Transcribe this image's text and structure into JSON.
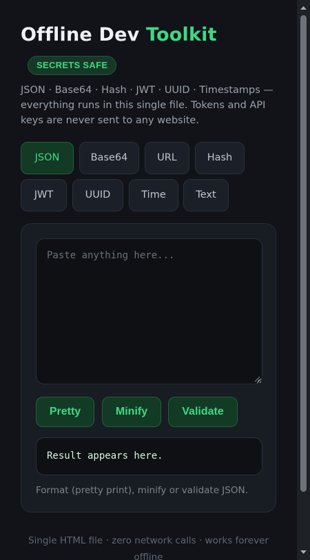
{
  "header": {
    "title_main": "Offline Dev ",
    "title_accent": "Toolkit",
    "badge": "SECRETS SAFE",
    "description": "JSON · Base64 · Hash · JWT · UUID · Timestamps — everything runs in this single file. Tokens and API keys are never sent to any website."
  },
  "tabs": [
    {
      "label": "JSON",
      "active": true
    },
    {
      "label": "Base64",
      "active": false
    },
    {
      "label": "URL",
      "active": false
    },
    {
      "label": "Hash",
      "active": false
    },
    {
      "label": "JWT",
      "active": false
    },
    {
      "label": "UUID",
      "active": false
    },
    {
      "label": "Time",
      "active": false
    },
    {
      "label": "Text",
      "active": false
    }
  ],
  "panel": {
    "input_placeholder": "Paste anything here...",
    "input_value": "",
    "buttons": {
      "pretty": "Pretty",
      "minify": "Minify",
      "validate": "Validate"
    },
    "result": "Result appears here.",
    "hint": "Format (pretty print), minify or validate JSON."
  },
  "footer": "Single HTML file · zero network calls · works forever offline",
  "colors": {
    "background": "#111318",
    "accent": "#3fd884",
    "panel": "#181c23",
    "button_bg": "#133a25"
  },
  "icons": {
    "resize": "resize-grip-icon",
    "scroll_up": "arrow-up-icon",
    "scroll_down": "arrow-down-icon"
  }
}
